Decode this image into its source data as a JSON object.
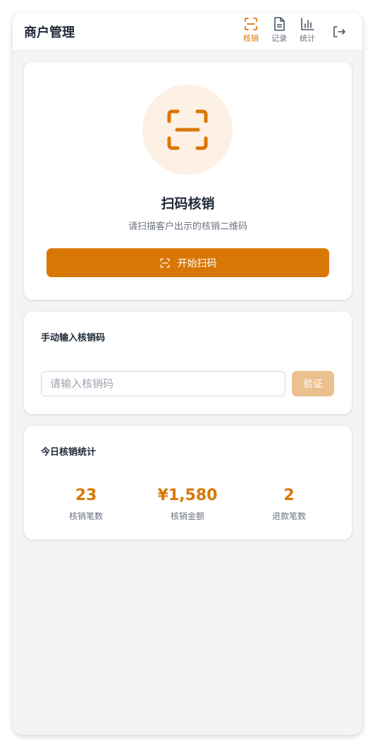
{
  "header": {
    "title": "商户管理",
    "nav": [
      {
        "label": "核销",
        "icon": "scan-icon",
        "active": true
      },
      {
        "label": "记录",
        "icon": "document-icon",
        "active": false
      },
      {
        "label": "统计",
        "icon": "bar-chart-icon",
        "active": false
      }
    ],
    "logout_icon": "logout-icon"
  },
  "scan_card": {
    "icon": "scan-icon",
    "title": "扫码核销",
    "subtitle": "请扫描客户出示的核销二维码",
    "button_label": "开始扫码"
  },
  "manual_card": {
    "title": "手动输入核销码",
    "input_placeholder": "请输入核销码",
    "input_value": "",
    "verify_label": "验证"
  },
  "stats_card": {
    "title": "今日核销统计",
    "stats": [
      {
        "value": "23",
        "label": "核销笔数"
      },
      {
        "value": "¥1,580",
        "label": "核销金额"
      },
      {
        "value": "2",
        "label": "退款笔数"
      }
    ]
  },
  "colors": {
    "accent": "#d97706",
    "accent_light": "#fdf0e4",
    "disabled_button": "#ebc08e",
    "background": "#f3f4f6"
  }
}
